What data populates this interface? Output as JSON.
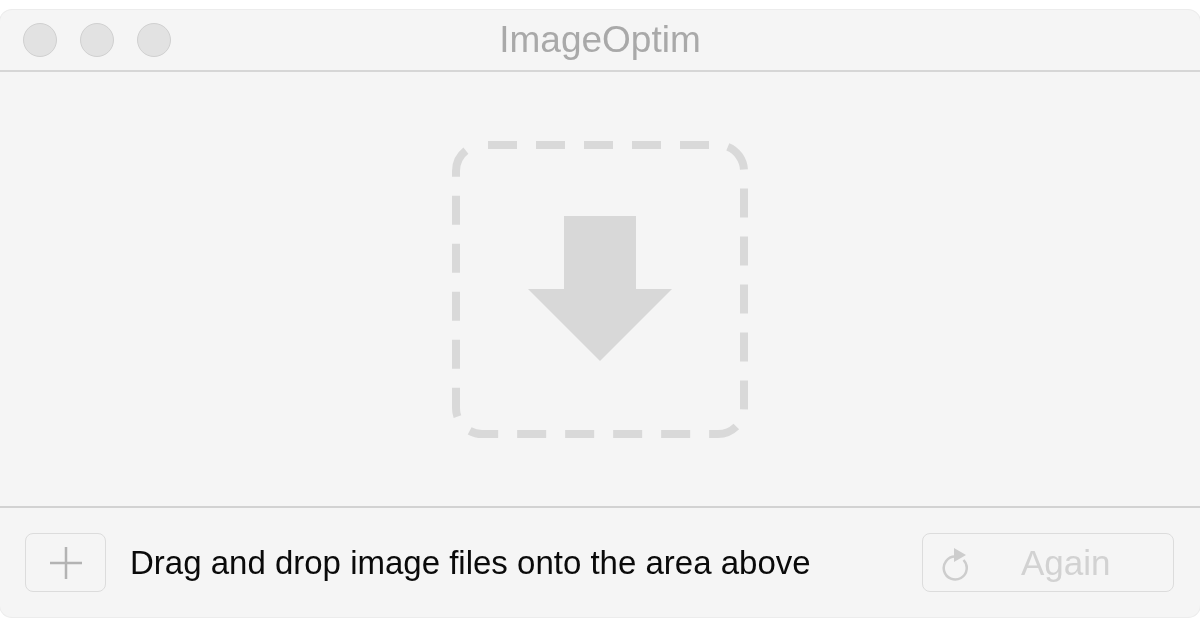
{
  "window": {
    "title": "ImageOptim",
    "focused": false
  },
  "footer": {
    "hint": "Drag and drop image files onto the area above",
    "again_button": {
      "label": "Again",
      "disabled": true
    }
  }
}
